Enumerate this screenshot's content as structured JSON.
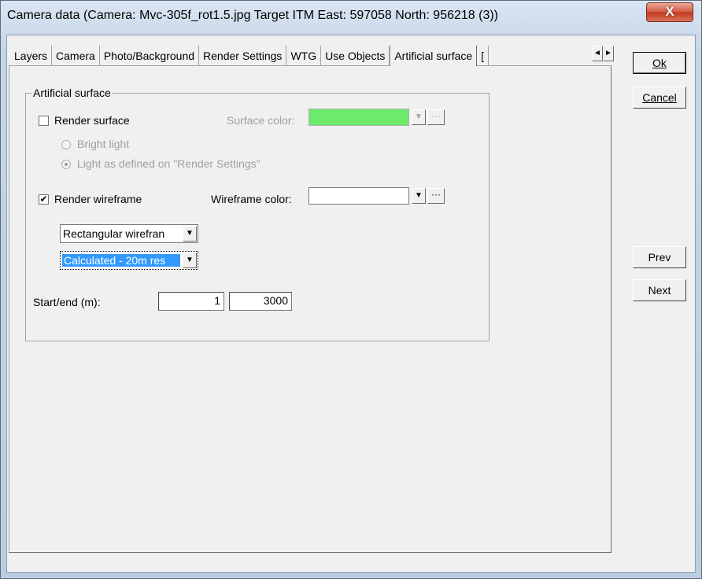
{
  "window": {
    "title": "Camera data  (Camera: Mvc-305f_rot1.5.jpg  Target ITM  East: 597058  North: 956218 (3))",
    "close_label": "X"
  },
  "tabs": [
    {
      "label": "Layers"
    },
    {
      "label": "Camera"
    },
    {
      "label": "Photo/Background"
    },
    {
      "label": "Render Settings"
    },
    {
      "label": "WTG"
    },
    {
      "label": "Use Objects"
    },
    {
      "label": "Artificial surface",
      "active": true
    },
    {
      "label": "["
    }
  ],
  "panel": {
    "group_title": "Artificial surface",
    "render_surface": {
      "label": "Render surface",
      "checked": false
    },
    "surface_color": {
      "label": "Surface color:",
      "color": "#6bea6b"
    },
    "radio_bright": {
      "label": "Bright light",
      "selected": false
    },
    "radio_defined": {
      "label": "Light as defined on \"Render Settings\"",
      "selected": true
    },
    "render_wireframe": {
      "label": "Render wireframe",
      "checked": true,
      "mark": "✔"
    },
    "wireframe_color": {
      "label": "Wireframe color:",
      "color": "#ffffff"
    },
    "wireframe_type": {
      "value": "Rectangular wirefran"
    },
    "wireframe_source": {
      "value": "Calculated - 20m res"
    },
    "start_end": {
      "label": "Start/end (m):",
      "start": "1",
      "end": "3000"
    }
  },
  "buttons": {
    "ok": "Ok",
    "cancel": "Cancel",
    "prev": "Prev",
    "next": "Next",
    "ellipsis": "···"
  },
  "icons": {
    "dropdown_arrow": "▼",
    "scroll_left": "◄",
    "scroll_right": "►"
  }
}
